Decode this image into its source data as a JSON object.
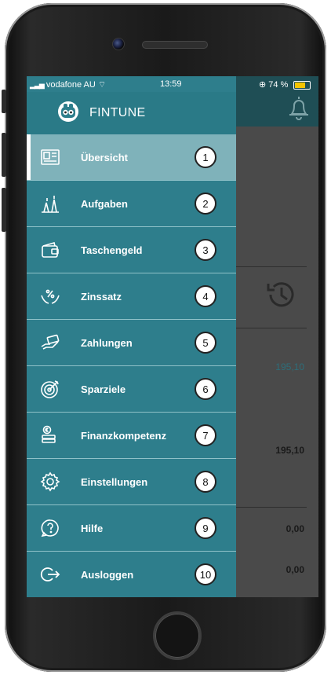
{
  "status_bar": {
    "carrier": "vodafone AU",
    "time": "13:59",
    "battery": "74 %"
  },
  "drawer": {
    "app_name": "FINTUNE",
    "items": [
      {
        "label": "Übersicht",
        "number": "1",
        "icon": "overview-icon"
      },
      {
        "label": "Aufgaben",
        "number": "2",
        "icon": "tasks-icon"
      },
      {
        "label": "Taschengeld",
        "number": "3",
        "icon": "wallet-icon"
      },
      {
        "label": "Zinssatz",
        "number": "4",
        "icon": "interest-hands-icon"
      },
      {
        "label": "Zahlungen",
        "number": "5",
        "icon": "payments-icon"
      },
      {
        "label": "Sparziele",
        "number": "6",
        "icon": "target-icon"
      },
      {
        "label": "Finanzkompetenz",
        "number": "7",
        "icon": "coin-stack-icon"
      },
      {
        "label": "Einstellungen",
        "number": "8",
        "icon": "gear-icon"
      },
      {
        "label": "Hilfe",
        "number": "9",
        "icon": "help-icon"
      },
      {
        "label": "Ausloggen",
        "number": "10",
        "icon": "logout-icon"
      }
    ]
  },
  "background": {
    "values": [
      "195,10",
      "195,10",
      "0,00",
      "0,00"
    ]
  },
  "colors": {
    "drawer": "#2e7e8c",
    "active_item": "#7fb2ba",
    "header": "#1f4e55"
  }
}
